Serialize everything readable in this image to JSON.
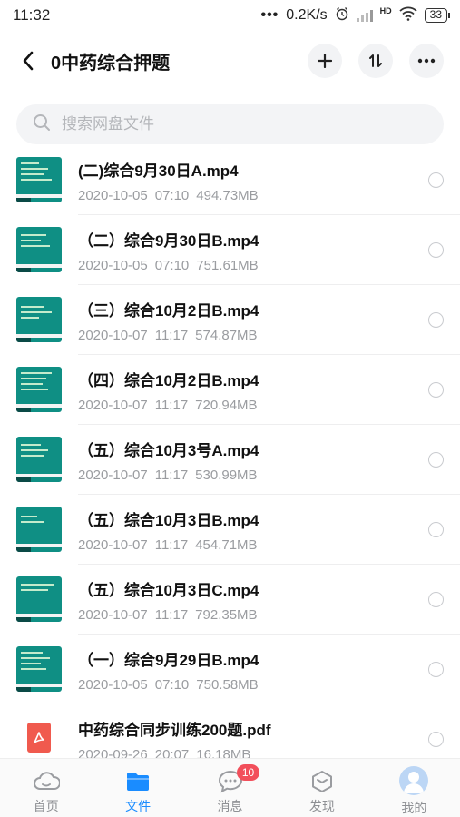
{
  "status": {
    "time": "11:32",
    "dots": "•••",
    "speed": "0.2K/s",
    "hd": "HD",
    "battery": "33"
  },
  "header": {
    "title": "0中药综合押题",
    "back_icon": "back-chevron-icon",
    "add_icon": "plus-icon",
    "sort_icon": "sort-icon",
    "more_icon": "more-dots-icon"
  },
  "search": {
    "placeholder": "搜索网盘文件"
  },
  "files": [
    {
      "name": "(二)综合9月30日A.mp4",
      "date": "2020-10-05",
      "time": "07:10",
      "size": "494.73MB",
      "type": "video"
    },
    {
      "name": "（二）综合9月30日B.mp4",
      "date": "2020-10-05",
      "time": "07:10",
      "size": "751.61MB",
      "type": "video"
    },
    {
      "name": "（三）综合10月2日B.mp4",
      "date": "2020-10-07",
      "time": "11:17",
      "size": "574.87MB",
      "type": "video"
    },
    {
      "name": "（四）综合10月2日B.mp4",
      "date": "2020-10-07",
      "time": "11:17",
      "size": "720.94MB",
      "type": "video"
    },
    {
      "name": "（五）综合10月3号A.mp4",
      "date": "2020-10-07",
      "time": "11:17",
      "size": "530.99MB",
      "type": "video"
    },
    {
      "name": "（五）综合10月3日B.mp4",
      "date": "2020-10-07",
      "time": "11:17",
      "size": "454.71MB",
      "type": "video"
    },
    {
      "name": "（五）综合10月3日C.mp4",
      "date": "2020-10-07",
      "time": "11:17",
      "size": "792.35MB",
      "type": "video"
    },
    {
      "name": "（一）综合9月29日B.mp4",
      "date": "2020-10-05",
      "time": "07:10",
      "size": "750.58MB",
      "type": "video"
    },
    {
      "name": "中药综合同步训练200题.pdf",
      "date": "2020-09-26",
      "time": "20:07",
      "size": "16.18MB",
      "type": "pdf"
    }
  ],
  "tabs": [
    {
      "label": "首页",
      "icon": "home-cloud-icon"
    },
    {
      "label": "文件",
      "icon": "folder-icon"
    },
    {
      "label": "消息",
      "icon": "chat-bubble-icon",
      "badge": "10"
    },
    {
      "label": "发现",
      "icon": "discover-cube-icon"
    },
    {
      "label": "我的",
      "icon": "avatar-icon"
    }
  ],
  "colors": {
    "accent": "#1a8cff",
    "badge": "#f24f5b",
    "thumb": "#0f8f84",
    "pdf": "#f05a4e"
  }
}
